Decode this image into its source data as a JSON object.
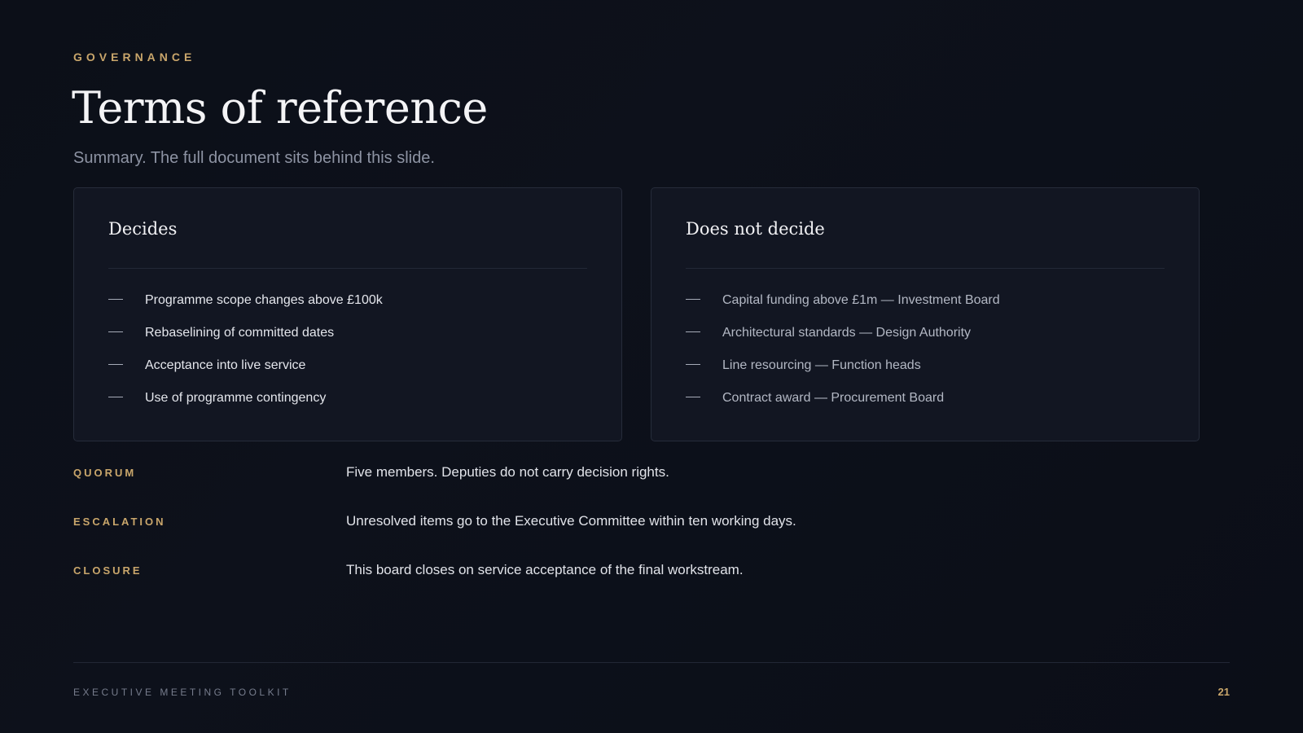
{
  "header": {
    "eyebrow": "GOVERNANCE",
    "title": "Terms of reference",
    "subtitle": "Summary. The full document sits behind this slide."
  },
  "decides": {
    "heading": "Decides",
    "items": [
      "Programme scope changes above £100k",
      "Rebaselining of committed dates",
      "Acceptance into live service",
      "Use of programme contingency"
    ]
  },
  "does_not_decide": {
    "heading": "Does not decide",
    "items": [
      "Capital funding above £1m — Investment Board",
      "Architectural standards — Design Authority",
      "Line resourcing — Function heads",
      "Contract award — Procurement Board"
    ]
  },
  "rules": [
    {
      "label": "QUORUM",
      "value": "Five members. Deputies do not carry decision rights."
    },
    {
      "label": "ESCALATION",
      "value": "Unresolved items go to the Executive Committee within ten working days."
    },
    {
      "label": "CLOSURE",
      "value": "This board closes on service acceptance of the final workstream."
    }
  ],
  "footer": {
    "left": "EXECUTIVE MEETING TOOLKIT",
    "page_number": "21"
  },
  "colors": {
    "accent": "#c9a66b",
    "background": "#0d111b",
    "card": "#121622"
  }
}
